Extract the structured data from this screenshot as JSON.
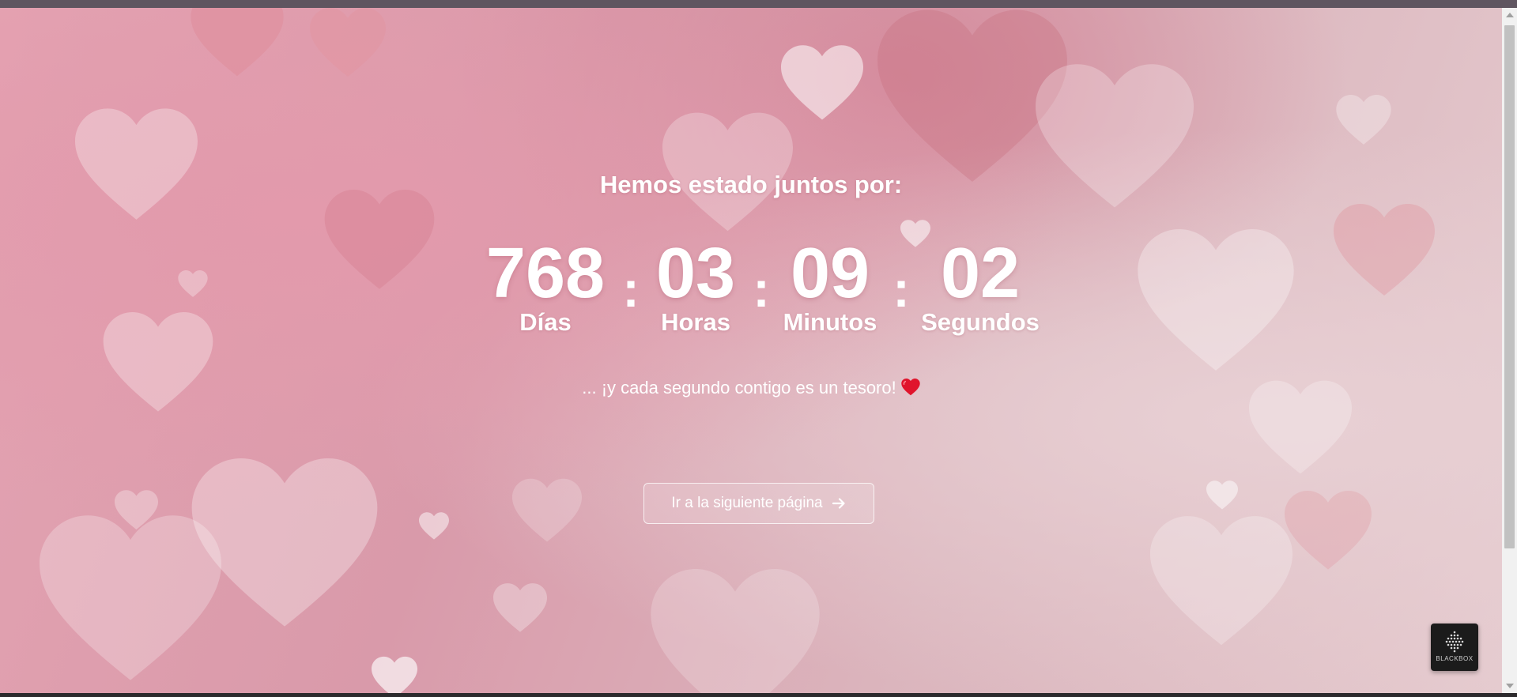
{
  "counter": {
    "heading": "Hemos estado juntos por:",
    "separator": ":",
    "units": [
      {
        "value": "768",
        "label": "Días"
      },
      {
        "value": "03",
        "label": "Horas"
      },
      {
        "value": "09",
        "label": "Minutos"
      },
      {
        "value": "02",
        "label": "Segundos"
      }
    ],
    "message": "... ¡y cada segundo contigo es un tesoro!",
    "message_icon": "red-heart-icon"
  },
  "next_button": {
    "label": "Ir a la siguiente página",
    "icon": "arrow-right-icon"
  },
  "badge": {
    "text": "BLACKBOX"
  },
  "colors": {
    "text": "#ffffff",
    "heart_accent": "#e0142c",
    "background_pink": "#e4a3b2",
    "badge_bg": "#1b1b1b"
  }
}
